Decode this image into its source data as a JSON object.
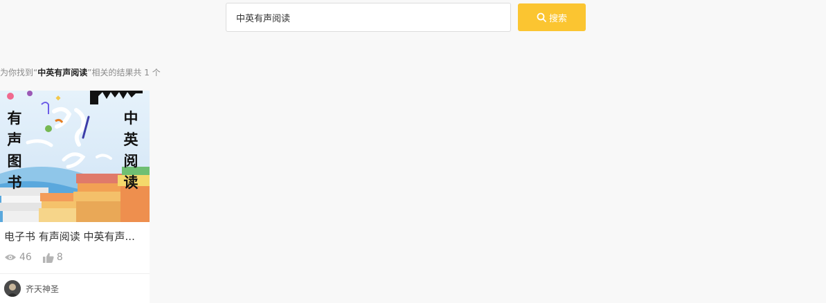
{
  "search": {
    "query": "中英有声阅读",
    "button_label": "搜索"
  },
  "result": {
    "prefix": "为你找到“",
    "keyword": "中英有声阅读",
    "suffix": "”相关的结果共",
    "count": "1",
    "unit": "个"
  },
  "card": {
    "cover_text_left": [
      "有",
      "声",
      "图",
      "书"
    ],
    "cover_text_right": [
      "中",
      "英",
      "阅",
      "读"
    ],
    "title": "电子书 有声阅读 中英有声...",
    "views": "46",
    "likes": "8",
    "author": "齐天神圣"
  },
  "colors": {
    "accent": "#fbc531",
    "background": "#f8f8f8"
  }
}
